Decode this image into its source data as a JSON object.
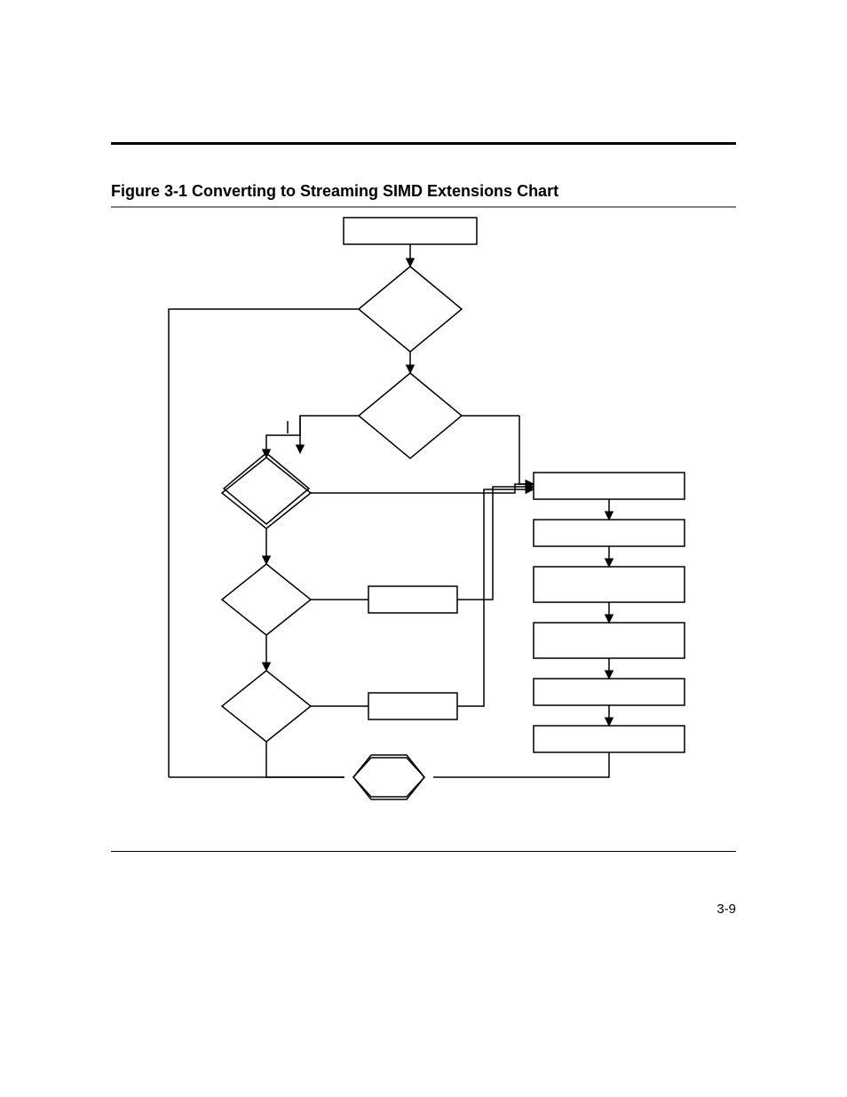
{
  "caption": "Figure 3-1   Converting to Streaming SIMD Extensions Chart",
  "page_number": "3-9",
  "flowchart": {
    "description": "Flowchart with a start box at top, two large decision diamonds stacked below it, three smaller decision diamonds on the left column, two small process boxes in the middle, six stacked process boxes on the right, and a hexagon connector at the bottom, all joined by directed arrows.",
    "nodes": [
      {
        "id": "start",
        "kind": "process",
        "label": ""
      },
      {
        "id": "d1",
        "kind": "decision",
        "label": ""
      },
      {
        "id": "d2",
        "kind": "decision",
        "label": ""
      },
      {
        "id": "d3",
        "kind": "decision",
        "label": ""
      },
      {
        "id": "d4",
        "kind": "decision",
        "label": ""
      },
      {
        "id": "d5",
        "kind": "decision",
        "label": ""
      },
      {
        "id": "p1",
        "kind": "process",
        "label": ""
      },
      {
        "id": "p2",
        "kind": "process",
        "label": ""
      },
      {
        "id": "r1",
        "kind": "process",
        "label": ""
      },
      {
        "id": "r2",
        "kind": "process",
        "label": ""
      },
      {
        "id": "r3",
        "kind": "process",
        "label": ""
      },
      {
        "id": "r4",
        "kind": "process",
        "label": ""
      },
      {
        "id": "r5",
        "kind": "process",
        "label": ""
      },
      {
        "id": "r6",
        "kind": "process",
        "label": ""
      },
      {
        "id": "hex",
        "kind": "connector-hexagon",
        "label": ""
      }
    ],
    "edges": [
      {
        "from": "start",
        "to": "d1"
      },
      {
        "from": "d1",
        "to": "d2"
      },
      {
        "from": "d1",
        "to": "left-bus",
        "note": "left exit routes down far-left rail to hex"
      },
      {
        "from": "d2",
        "to": "d3",
        "note": "left branch"
      },
      {
        "from": "d2",
        "to": "r1",
        "note": "right branch"
      },
      {
        "from": "d3",
        "to": "r1",
        "note": "right branch"
      },
      {
        "from": "d3",
        "to": "d4"
      },
      {
        "from": "d4",
        "to": "p1",
        "note": "right branch"
      },
      {
        "from": "p1",
        "to": "r1"
      },
      {
        "from": "d4",
        "to": "d5"
      },
      {
        "from": "d5",
        "to": "p2",
        "note": "right branch"
      },
      {
        "from": "p2",
        "to": "r1"
      },
      {
        "from": "d5",
        "to": "hex",
        "note": "bottom exit"
      },
      {
        "from": "r1",
        "to": "r2"
      },
      {
        "from": "r2",
        "to": "r3"
      },
      {
        "from": "r3",
        "to": "r4"
      },
      {
        "from": "r4",
        "to": "r5"
      },
      {
        "from": "r5",
        "to": "r6"
      },
      {
        "from": "r6",
        "to": "hex"
      },
      {
        "from": "hex",
        "to": "d1",
        "note": "loop back via far-left rail"
      }
    ]
  }
}
